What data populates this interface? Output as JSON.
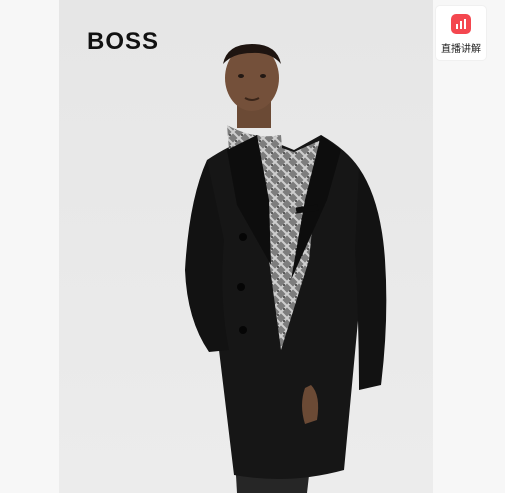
{
  "brand": {
    "logo_text": "BOSS"
  },
  "live_button": {
    "label": "直播讲解",
    "icon": "live-chart-icon",
    "color": "#f4474f"
  },
  "product_image": {
    "subject": "model-wearing-black-wool-coat"
  }
}
